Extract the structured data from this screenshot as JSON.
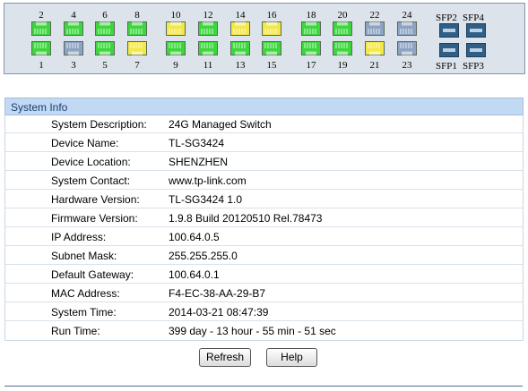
{
  "ports": [
    {
      "label": "1",
      "color": "#3ed63e"
    },
    {
      "label": "2",
      "color": "#3ed63e"
    },
    {
      "label": "3",
      "color": "#8ca3c2"
    },
    {
      "label": "4",
      "color": "#3ed63e"
    },
    {
      "label": "5",
      "color": "#3ed63e"
    },
    {
      "label": "6",
      "color": "#3ed63e"
    },
    {
      "label": "7",
      "color": "#f2e84a"
    },
    {
      "label": "8",
      "color": "#3ed63e"
    },
    {
      "label": "9",
      "color": "#3ed63e"
    },
    {
      "label": "10",
      "color": "#f2e84a"
    },
    {
      "label": "11",
      "color": "#3ed63e"
    },
    {
      "label": "12",
      "color": "#3ed63e"
    },
    {
      "label": "13",
      "color": "#3ed63e"
    },
    {
      "label": "14",
      "color": "#f2e84a"
    },
    {
      "label": "15",
      "color": "#3ed63e"
    },
    {
      "label": "16",
      "color": "#f2e84a"
    },
    {
      "label": "17",
      "color": "#3ed63e"
    },
    {
      "label": "18",
      "color": "#3ed63e"
    },
    {
      "label": "19",
      "color": "#3ed63e"
    },
    {
      "label": "20",
      "color": "#3ed63e"
    },
    {
      "label": "21",
      "color": "#f2e84a"
    },
    {
      "label": "22",
      "color": "#8ca3c2"
    },
    {
      "label": "23",
      "color": "#8ca3c2"
    },
    {
      "label": "24",
      "color": "#8ca3c2"
    }
  ],
  "sfp": {
    "sfp1": "SFP1",
    "sfp2": "SFP2",
    "sfp3": "SFP3",
    "sfp4": "SFP4"
  },
  "info": {
    "title": "System Info",
    "rows": [
      {
        "label": "System Description:",
        "value": "24G Managed Switch"
      },
      {
        "label": "Device Name:",
        "value": "TL-SG3424"
      },
      {
        "label": "Device Location:",
        "value": "SHENZHEN"
      },
      {
        "label": "System Contact:",
        "value": "www.tp-link.com"
      },
      {
        "label": "Hardware Version:",
        "value": "TL-SG3424 1.0"
      },
      {
        "label": "Firmware Version:",
        "value": "1.9.8 Build 20120510 Rel.78473"
      },
      {
        "label": "IP Address:",
        "value": "100.64.0.5"
      },
      {
        "label": "Subnet Mask:",
        "value": "255.255.255.0"
      },
      {
        "label": "Default Gateway:",
        "value": "100.64.0.1"
      },
      {
        "label": "MAC Address:",
        "value": "F4-EC-38-AA-29-B7"
      },
      {
        "label": "System Time:",
        "value": "2014-03-21 08:47:39"
      },
      {
        "label": "Run Time:",
        "value": "399 day - 13 hour - 55 min - 51 sec"
      }
    ]
  },
  "buttons": {
    "refresh": "Refresh",
    "help": "Help"
  }
}
